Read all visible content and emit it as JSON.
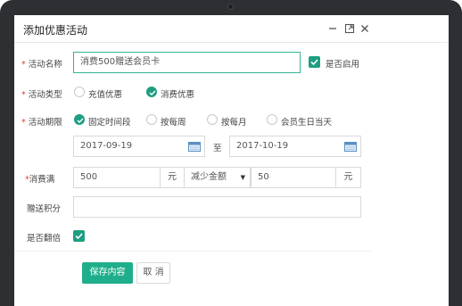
{
  "dialog": {
    "title": "添加优惠活动"
  },
  "form": {
    "name": {
      "label": "活动名称",
      "value": "消费500赠送会员卡",
      "enable_label": "是否启用",
      "enabled": true
    },
    "type": {
      "label": "活动类型",
      "options": [
        {
          "label": "充值优惠",
          "selected": false
        },
        {
          "label": "消费优惠",
          "selected": true
        }
      ]
    },
    "period": {
      "label": "活动期限",
      "options": [
        {
          "label": "固定时间段",
          "selected": true
        },
        {
          "label": "按每周",
          "selected": false
        },
        {
          "label": "按每月",
          "selected": false
        },
        {
          "label": "会员生日当天",
          "selected": false
        }
      ],
      "start": "2017-09-19",
      "separator": "至",
      "end": "2017-10-19"
    },
    "spend": {
      "label": "消费满",
      "amount": "500",
      "unit": "元",
      "mode": "减少金额",
      "reduce_amount": "50",
      "reduce_unit": "元"
    },
    "points": {
      "label": "赠送积分",
      "value": ""
    },
    "double": {
      "label": "是否翻倍",
      "checked": true
    }
  },
  "buttons": {
    "save": "保存内容",
    "cancel": "取 消"
  },
  "colors": {
    "accent": "#1fae8b",
    "required": "#e23b3b",
    "bezel": "#2e2f33"
  },
  "icons": {
    "minimize": "minimize-icon",
    "maximize": "maximize-icon",
    "close": "close-icon",
    "calendar": "calendar-icon"
  }
}
